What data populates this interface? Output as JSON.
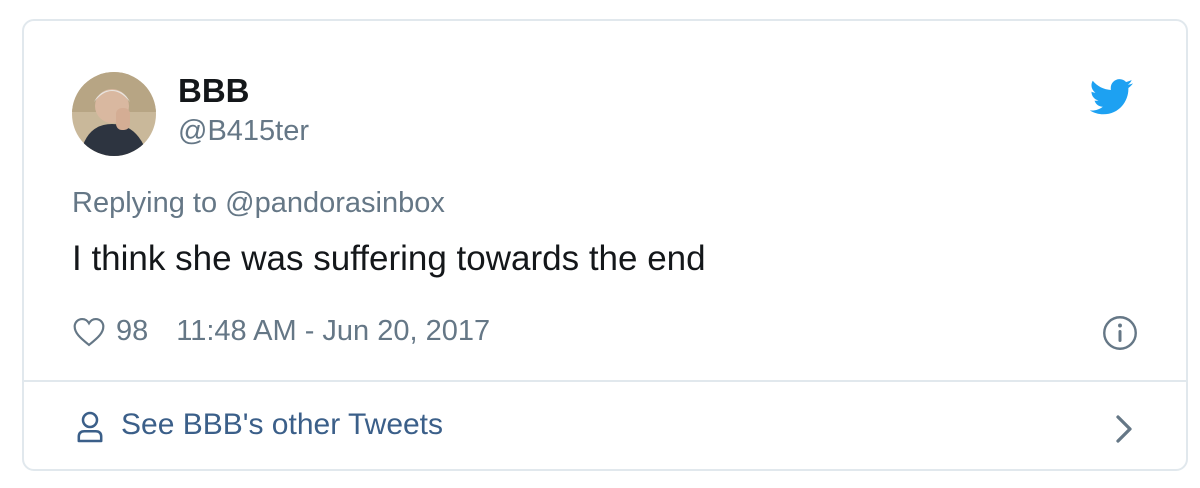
{
  "author": {
    "display_name": "BBB",
    "handle": "@B415ter",
    "avatar_icon": "user-avatar"
  },
  "tweet": {
    "replying_prefix": "Replying to ",
    "replying_to": "@pandorasinbox",
    "text": "I think she was suffering towards the end",
    "like_count": "98",
    "timestamp": "11:48 AM - Jun 20, 2017"
  },
  "footer": {
    "label": "See BBB's other Tweets"
  },
  "icons": {
    "brand": "twitter-bird-icon",
    "like": "heart-icon",
    "info": "info-icon",
    "profile": "person-icon",
    "forward": "chevron-right-icon"
  },
  "colors": {
    "twitter_blue": "#1da1f2",
    "muted_text": "#657786",
    "primary_text": "#14171a",
    "link": "#3b5f89",
    "border": "#e1e8ed"
  }
}
